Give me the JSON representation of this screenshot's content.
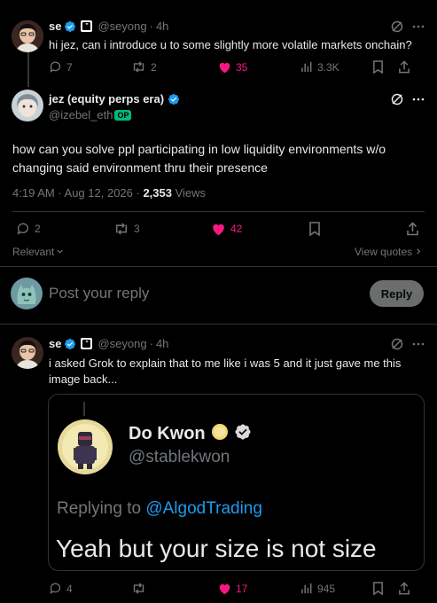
{
  "tweet1": {
    "name": "se",
    "handle": "@seyong",
    "time": "4h",
    "text": "hi jez, can i introduce u to some slightly more volatile markets onchain?",
    "replies": "7",
    "retweets": "2",
    "likes": "35",
    "views": "3.3K"
  },
  "main": {
    "name": "jez (equity perps era)",
    "handle": "@izebel_eth",
    "op_badge": "OP",
    "text": "how can you solve ppl participating in low liquidity environments w/o changing said environment thru their presence",
    "timestamp": "4:19 AM · Aug 12, 2026 · ",
    "views_count": "2,353",
    "views_label": " Views",
    "replies": "2",
    "retweets": "3",
    "likes": "42",
    "relevant": "Relevant",
    "view_quotes": "View quotes"
  },
  "composer": {
    "placeholder": "Post your reply",
    "button": "Reply"
  },
  "tweet2": {
    "name": "se",
    "handle": "@seyong",
    "time": "4h",
    "text": "i asked Grok to explain that to me like i was 5 and it just gave me this image back...",
    "replies": "4",
    "retweets": "",
    "likes": "17",
    "views": "945",
    "image": {
      "name": "Do Kwon",
      "handle": "@stablekwon",
      "replying_prefix": "Replying to ",
      "replying_handle": "@AlgodTrading",
      "quote": "Yeah but your size is not size"
    }
  },
  "colors": {
    "accent": "#1d9bf0",
    "like": "#f91880",
    "muted": "#71767b",
    "verified": "#1d9bf0"
  }
}
